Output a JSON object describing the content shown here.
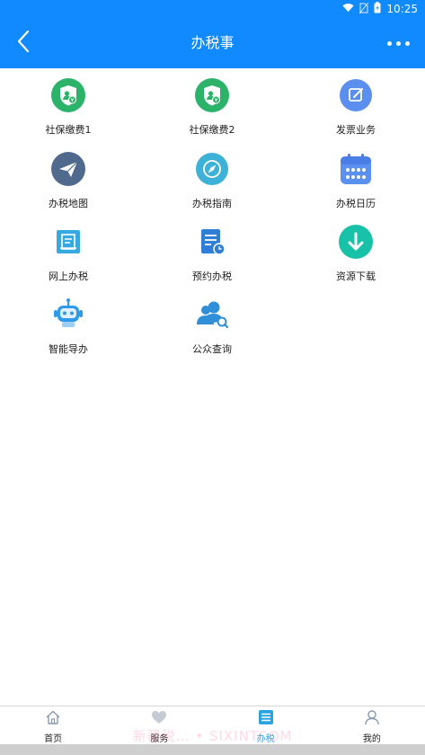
{
  "status_bar": {
    "time": "10:25"
  },
  "header": {
    "title": "办税事"
  },
  "grid": {
    "items": [
      {
        "label": "社保缴费1",
        "icon": "social-security-shield-icon",
        "color": "#2bb36a"
      },
      {
        "label": "社保缴费2",
        "icon": "social-security-shield-icon",
        "color": "#2bb36a"
      },
      {
        "label": "发票业务",
        "icon": "invoice-edit-icon",
        "color": "#5a8ff0"
      },
      {
        "label": "办税地图",
        "icon": "paper-plane-icon",
        "color": "#4f6a8c"
      },
      {
        "label": "办税指南",
        "icon": "compass-icon",
        "color": "#3eb1d8"
      },
      {
        "label": "办税日历",
        "icon": "calendar-icon",
        "color": "#5a90f0"
      },
      {
        "label": "网上办税",
        "icon": "online-document-icon",
        "color": "#35a9e0"
      },
      {
        "label": "预约办税",
        "icon": "appointment-document-icon",
        "color": "#2f7fd8"
      },
      {
        "label": "资源下载",
        "icon": "download-icon",
        "color": "#17c2a8"
      },
      {
        "label": "智能导办",
        "icon": "robot-icon",
        "color": "#2e9be8"
      },
      {
        "label": "公众查询",
        "icon": "user-search-icon",
        "color": "#2f8fd8"
      }
    ]
  },
  "tabbar": {
    "tabs": [
      {
        "label": "首页",
        "icon": "home-icon"
      },
      {
        "label": "服务",
        "icon": "heart-icon"
      },
      {
        "label": "办税",
        "icon": "list-icon",
        "active": true
      },
      {
        "label": "我的",
        "icon": "user-icon"
      }
    ],
    "active_color": "#2aa4e0"
  },
  "watermark": "新疆税… • SIXINTCOM"
}
